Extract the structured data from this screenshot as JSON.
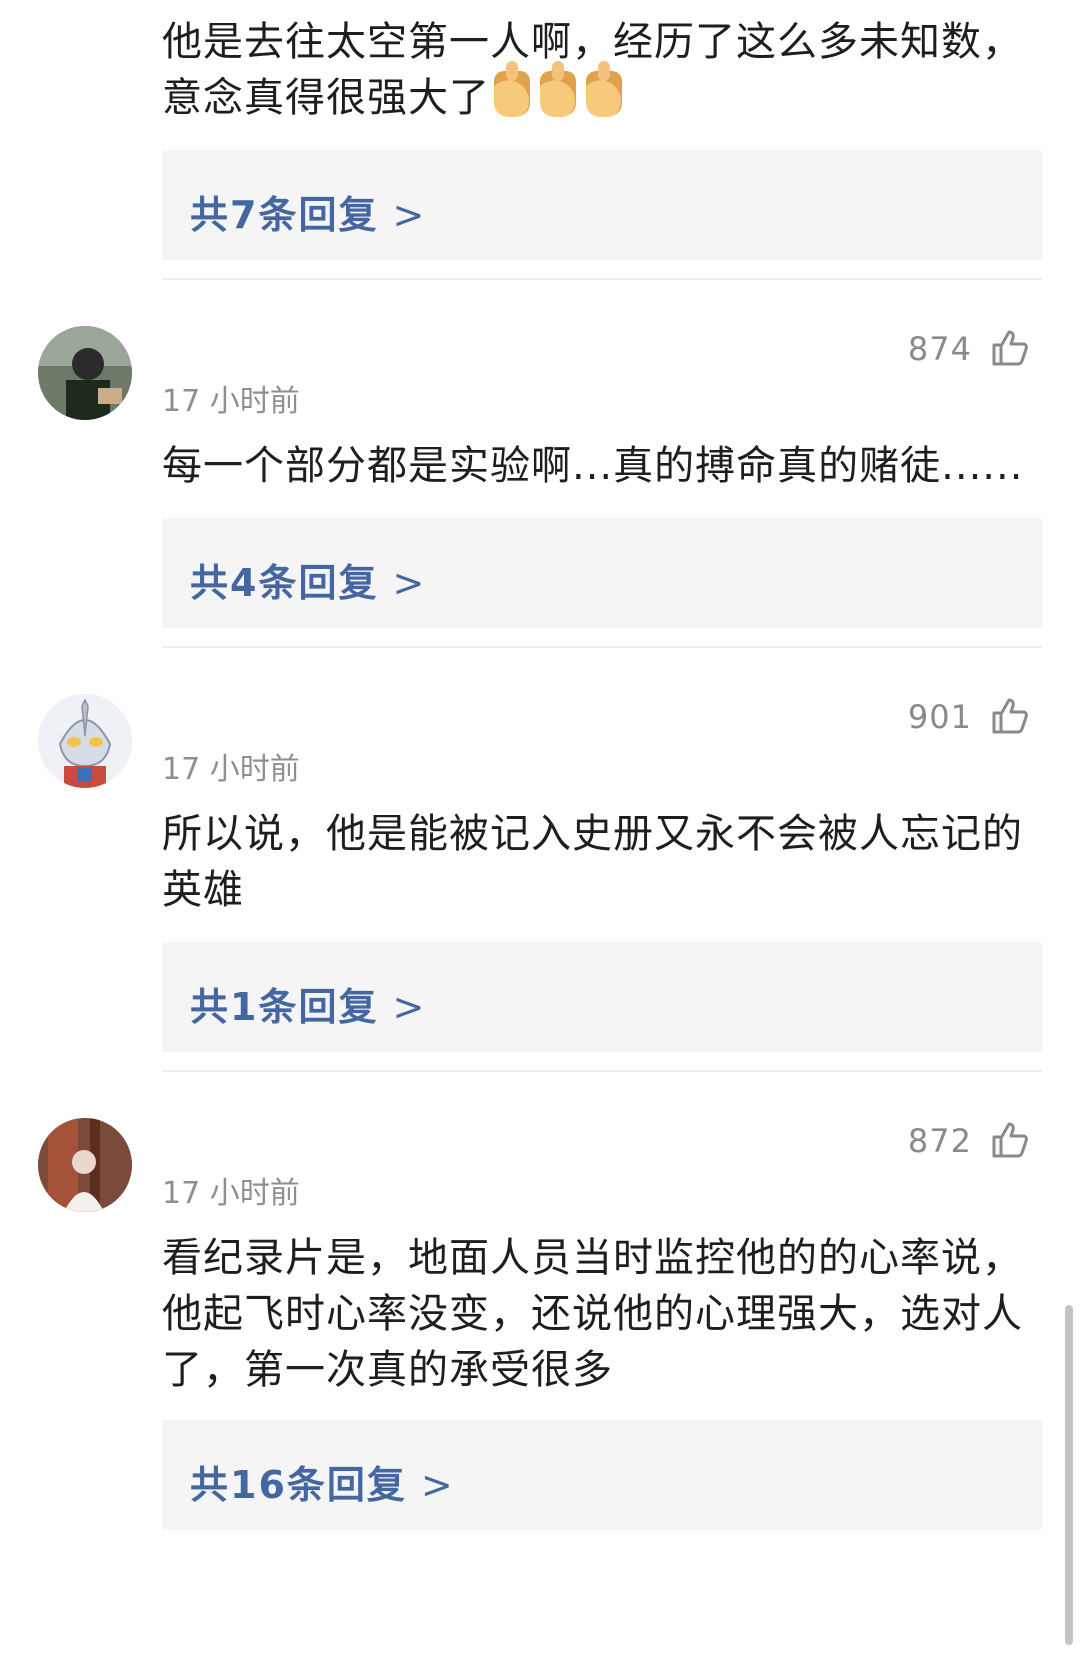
{
  "comments": [
    {
      "text": "他是去往太空第一人啊，经历了这么多未知数，意念真得很强大了",
      "emoji": "thumbs-up-emoji",
      "replies_label": "共7条回复"
    },
    {
      "likes": "874",
      "time": "17 小时前",
      "text": "每一个部分都是实验啊...真的搏命真的赌徒......",
      "replies_label": "共4条回复",
      "avatar": "photo-avatar"
    },
    {
      "likes": "901",
      "time": "17 小时前",
      "text": "所以说，他是能被记入史册又永不会被人忘记的英雄",
      "replies_label": "共1条回复",
      "avatar": "ultraman-avatar"
    },
    {
      "likes": "872",
      "time": "17 小时前",
      "text": "看纪录片是，地面人员当时监控他的的心率说，他起飞时心率没变，还说他的心理强大，选对人了，第一次真的承受很多",
      "replies_label": "共16条回复",
      "avatar": "photo-avatar"
    }
  ],
  "reply_chevron": ">",
  "colors": {
    "reply_link": "#43679e",
    "reply_box": "#f5f5f5",
    "meta_text": "#8f8f8f",
    "body_text": "#1e1e1e"
  }
}
